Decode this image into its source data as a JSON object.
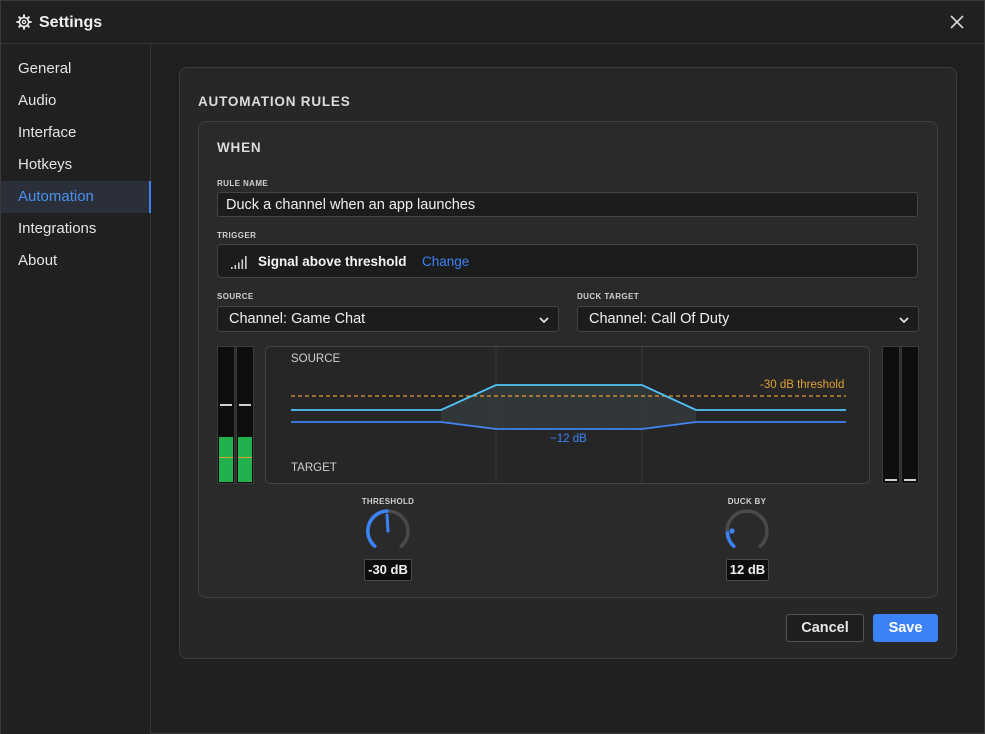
{
  "window": {
    "title": "Settings",
    "gear_icon": "gear-icon",
    "close_icon": "close-icon"
  },
  "sidebar": {
    "items": [
      {
        "label": "General"
      },
      {
        "label": "Audio"
      },
      {
        "label": "Interface"
      },
      {
        "label": "Hotkeys"
      },
      {
        "label": "Automation",
        "active": true
      },
      {
        "label": "Integrations"
      },
      {
        "label": "About"
      }
    ]
  },
  "main": {
    "section_title": "AUTOMATION RULES",
    "card_title": "WHEN",
    "rule_name": {
      "label": "RULE NAME",
      "value": "Duck a channel when an app launches"
    },
    "trigger": {
      "label": "TRIGGER",
      "value": "Signal above threshold",
      "change_label": "Change",
      "icon": "signal-bars-icon"
    },
    "source": {
      "label": "SOURCE",
      "value": "Channel: Game Chat"
    },
    "duck_target": {
      "label": "DUCK TARGET",
      "value": "Channel: Call Of Duty"
    },
    "graph": {
      "source_label": "SOURCE",
      "target_label": "TARGET",
      "threshold_label": "-30 dB threshold",
      "duck_label": "−12 dB"
    },
    "meters": {
      "source_level": 0.33,
      "target_level": 0.0
    },
    "threshold": {
      "label": "THRESHOLD",
      "value": "-30 dB"
    },
    "duck_by": {
      "label": "DUCK BY",
      "value": "12 dB"
    }
  },
  "footer": {
    "cancel_label": "Cancel",
    "save_label": "Save"
  },
  "colors": {
    "accent": "#3b82f6",
    "threshold": "#e0a030",
    "source_line": "#4fc3f7",
    "meter_green": "#22b14c"
  }
}
